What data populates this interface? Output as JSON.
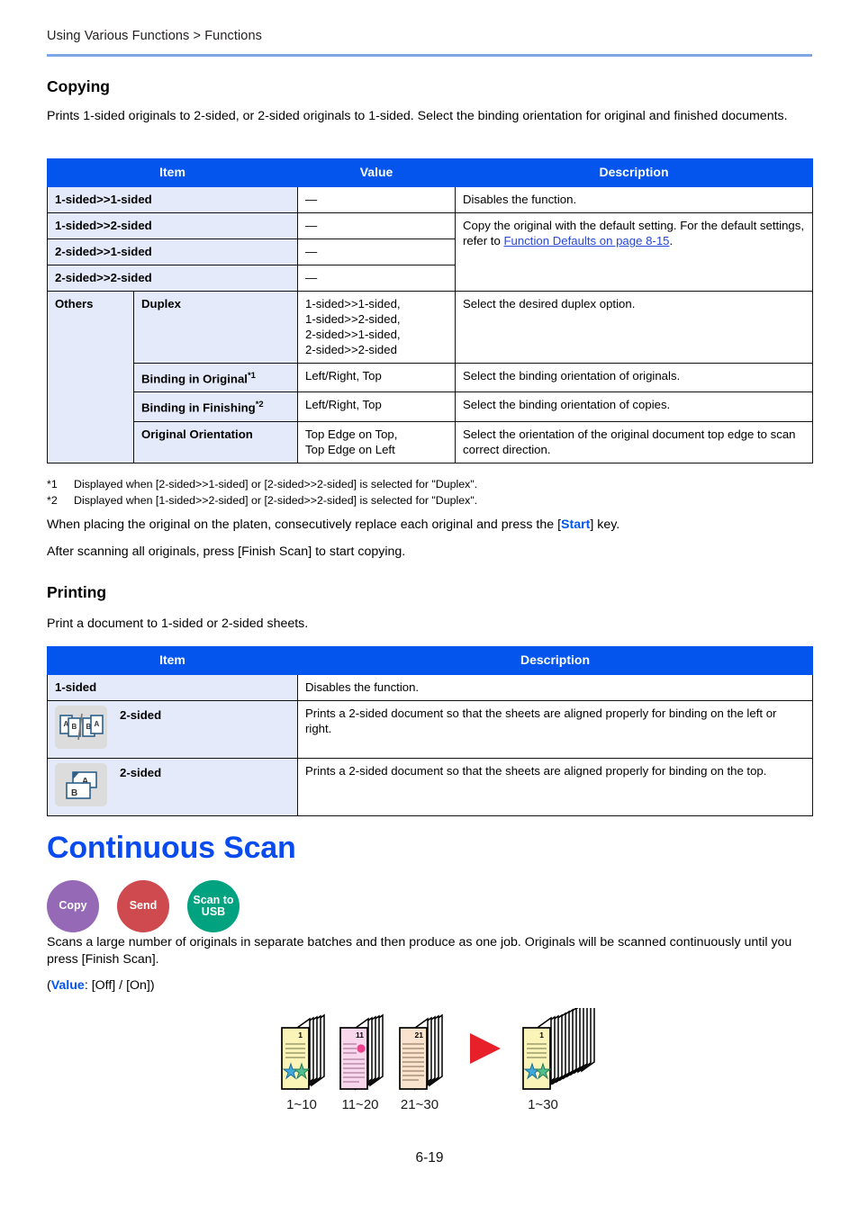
{
  "header": {
    "breadcrumb": "Using Various Functions > Functions"
  },
  "copying": {
    "heading": "Copying",
    "intro": "Prints 1-sided originals to 2-sided, or 2-sided originals to 1-sided. Select the binding orientation for original and finished documents.",
    "table": {
      "columns": [
        "Item",
        "Value",
        "Description"
      ],
      "rows": [
        {
          "item": "1-sided>>1-sided",
          "value": "—",
          "desc": "Disables the function."
        },
        {
          "item": "1-sided>>2-sided",
          "value": "—",
          "desc_pre": "Copy the original with the default setting. For the default settings, refer to ",
          "desc_link": "Function Defaults on page 8-15",
          "desc_post": "."
        },
        {
          "item": "2-sided>>1-sided",
          "value": "—"
        },
        {
          "item": "2-sided>>2-sided",
          "value": "—"
        }
      ],
      "others_label": "Others",
      "others_rows": [
        {
          "item": "Duplex",
          "footnote": "",
          "value": "1-sided>>1-sided,\n1-sided>>2-sided,\n2-sided>>1-sided,\n2-sided>>2-sided",
          "desc": "Select the desired duplex option."
        },
        {
          "item": "Binding in Original",
          "footnote": "*1",
          "value": "Left/Right, Top",
          "desc": "Select the binding orientation of originals."
        },
        {
          "item": "Binding in Finishing",
          "footnote": "*2",
          "value": "Left/Right, Top",
          "desc": "Select the binding orientation of copies."
        },
        {
          "item": "Original Orientation",
          "footnote": "",
          "value": "Top Edge on Top,\nTop Edge on Left",
          "desc": "Select the orientation of the original document top edge to scan correct direction."
        }
      ]
    },
    "footnotes": [
      {
        "mark": "*1",
        "text": "Displayed when [2-sided>>1-sided] or [2-sided>>2-sided] is selected for \"Duplex\"."
      },
      {
        "mark": "*2",
        "text": "Displayed when [1-sided>>2-sided] or [2-sided>>2-sided] is selected for \"Duplex\"."
      }
    ],
    "note1_pre": "When placing the original on the platen, consecutively replace each original and press the [",
    "note1_kw": "Start",
    "note1_post": "] key.",
    "note2": "After scanning all originals, press [Finish Scan] to start copying."
  },
  "printing": {
    "heading": "Printing",
    "intro": "Print a document to 1-sided or 2-sided sheets.",
    "table": {
      "columns": [
        "Item",
        "Description"
      ],
      "rows": [
        {
          "icon": "",
          "item": "1-sided",
          "desc": "Disables the function."
        },
        {
          "icon": "duplex-left-right-icon",
          "item": "2-sided",
          "desc": "Prints a 2-sided document so that the sheets are aligned properly for binding on the left or right."
        },
        {
          "icon": "duplex-top-icon",
          "item": "2-sided",
          "desc": "Prints a 2-sided document so that the sheets are aligned properly for binding on the top."
        }
      ]
    }
  },
  "continuous_scan": {
    "heading": "Continuous Scan",
    "badges": [
      {
        "label": "Copy",
        "color": "#9669B6"
      },
      {
        "label": "Send",
        "color": "#CE4A4E"
      },
      {
        "label": "Scan to\nUSB",
        "color": "#00A280"
      }
    ],
    "intro": "Scans a large number of originals in separate batches and then produce as one job. Originals will be scanned continuously until you press [Finish Scan].",
    "value_pre": "(",
    "value_kw": "Value",
    "value_post": ": [Off] / [On])",
    "illustration": {
      "stacks": [
        {
          "page_number": "1",
          "caption": "1~10",
          "paper": "#FAF4B8"
        },
        {
          "page_number": "11",
          "caption": "11~20",
          "paper": "#F8D7EC"
        },
        {
          "page_number": "21",
          "caption": "21~30",
          "paper": "#FAE3CE"
        }
      ],
      "arrow": "right-arrow-icon",
      "result": {
        "page_number": "1",
        "caption": "1~30",
        "paper": "#FAF4B8"
      }
    }
  },
  "footer": {
    "page_number": "6-19"
  }
}
